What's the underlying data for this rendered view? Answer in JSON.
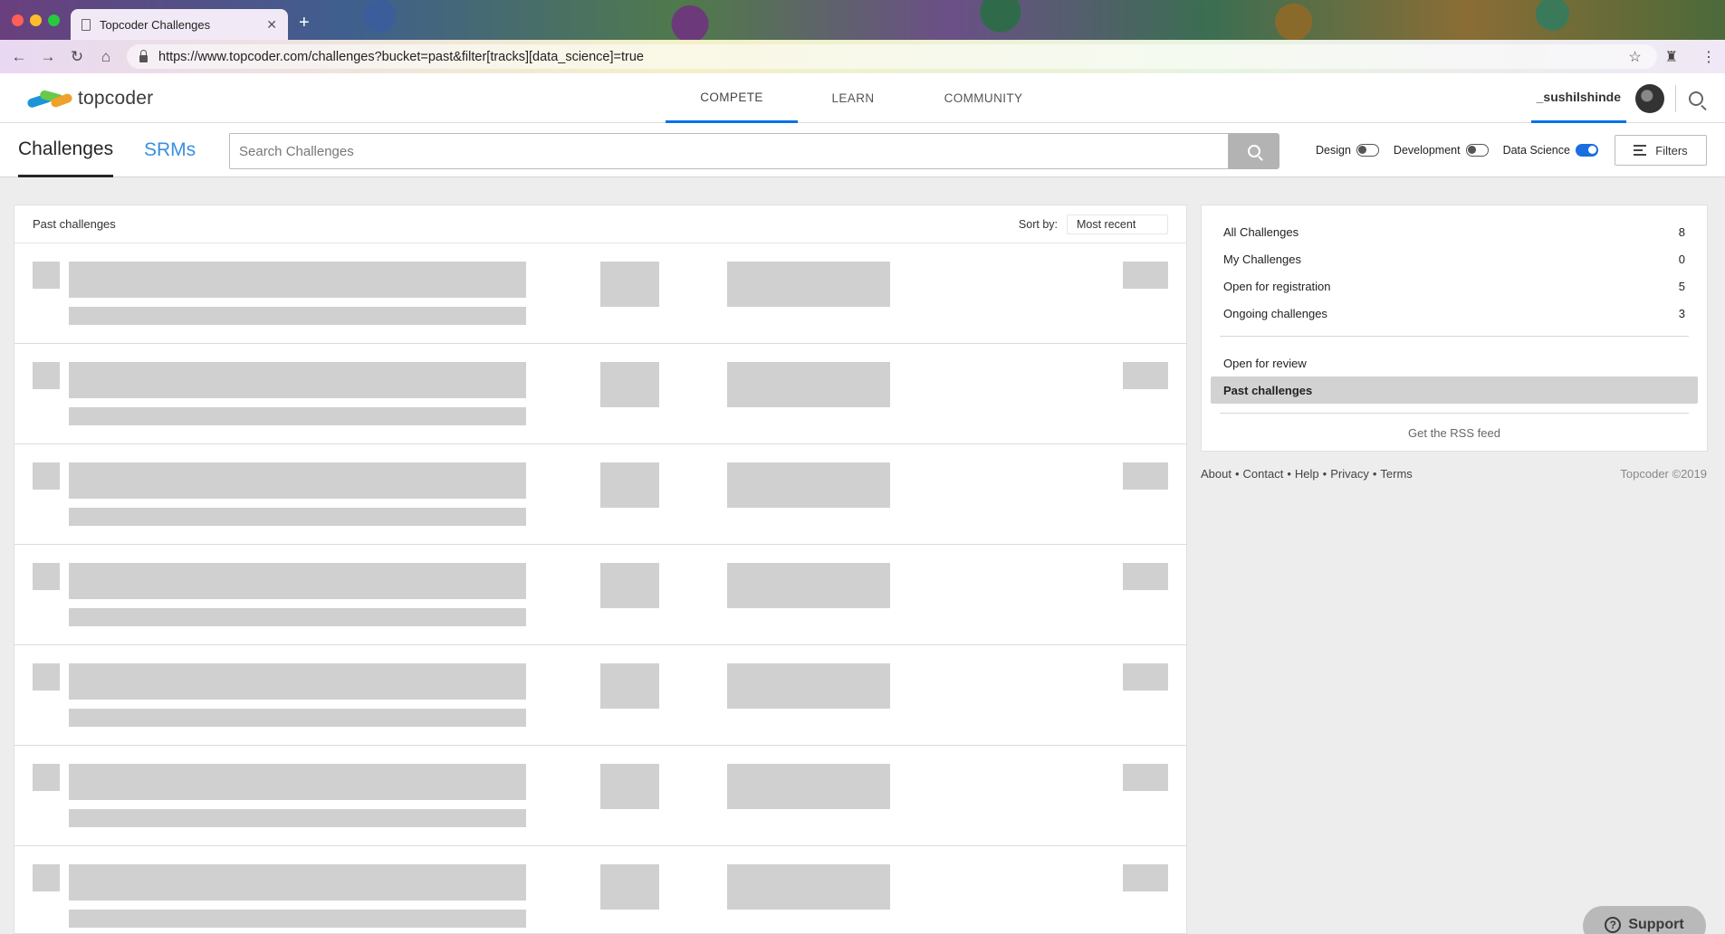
{
  "browser": {
    "tab_title": "Topcoder Challenges",
    "new_tab_label": "+",
    "url": "https://www.topcoder.com/challenges?bucket=past&filter[tracks][data_science]=true"
  },
  "header": {
    "logo_text": "topcoder",
    "nav": [
      {
        "label": "COMPETE",
        "active": true
      },
      {
        "label": "LEARN",
        "active": false
      },
      {
        "label": "COMMUNITY",
        "active": false
      }
    ],
    "username": "_sushilshinde"
  },
  "subheader": {
    "tabs": {
      "challenges": "Challenges",
      "srms": "SRMs"
    },
    "search_placeholder": "Search Challenges",
    "toggles": [
      {
        "label": "Design",
        "on": false
      },
      {
        "label": "Development",
        "on": false
      },
      {
        "label": "Data Science",
        "on": true
      }
    ],
    "filters_label": "Filters"
  },
  "list": {
    "title": "Past challenges",
    "sort_label": "Sort by:",
    "sort_value": "Most recent",
    "loading_rows": 7
  },
  "sidebar": {
    "buckets_top": [
      {
        "label": "All Challenges",
        "count": "8"
      },
      {
        "label": "My Challenges",
        "count": "0"
      },
      {
        "label": "Open for registration",
        "count": "5"
      },
      {
        "label": "Ongoing challenges",
        "count": "3"
      }
    ],
    "buckets_bottom": [
      {
        "label": "Open for review",
        "active": false
      },
      {
        "label": "Past challenges",
        "active": true
      }
    ],
    "rss_label": "Get the RSS feed"
  },
  "footer": {
    "links": [
      "About",
      "Contact",
      "Help",
      "Privacy",
      "Terms"
    ],
    "copyright": "Topcoder ©2019"
  },
  "support_label": "Support",
  "colors": {
    "accent": "#0b71e6",
    "srms": "#3a8fe0",
    "skeleton": "#d0d0d0",
    "active_bucket": "#d2d2d2"
  }
}
